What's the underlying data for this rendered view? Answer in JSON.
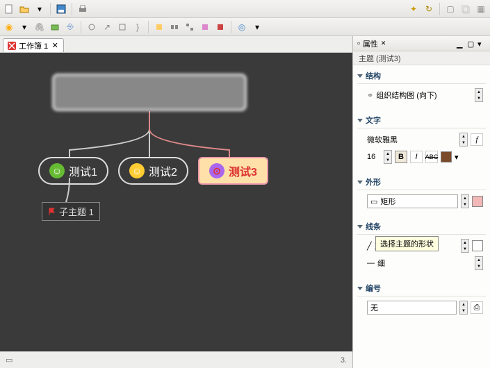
{
  "tab": {
    "title": "工作簿 1"
  },
  "canvas": {
    "node1": "测试1",
    "node2": "测试2",
    "node3": "测试3",
    "subnode": "子主题 1"
  },
  "props": {
    "panel_title": "属性",
    "subheader": "主题 (测试3)",
    "sections": {
      "structure": {
        "title": "结构",
        "value": "组织结构图 (向下)"
      },
      "text": {
        "title": "文字",
        "font": "微软雅黑",
        "size": "16"
      },
      "shape": {
        "title": "外形",
        "value": "矩形"
      },
      "line": {
        "title": "线条",
        "style": "直线",
        "weight": "细"
      },
      "number": {
        "title": "编号",
        "value": "无"
      }
    }
  },
  "tooltip": "选择主题的形状",
  "bottom": {
    "page": "3."
  },
  "colors": {
    "node3_bg": "#ffe0a8",
    "node3_text": "#d33",
    "shape_swatch": "#f2b8b8",
    "text_swatch": "#7a4a2a"
  }
}
